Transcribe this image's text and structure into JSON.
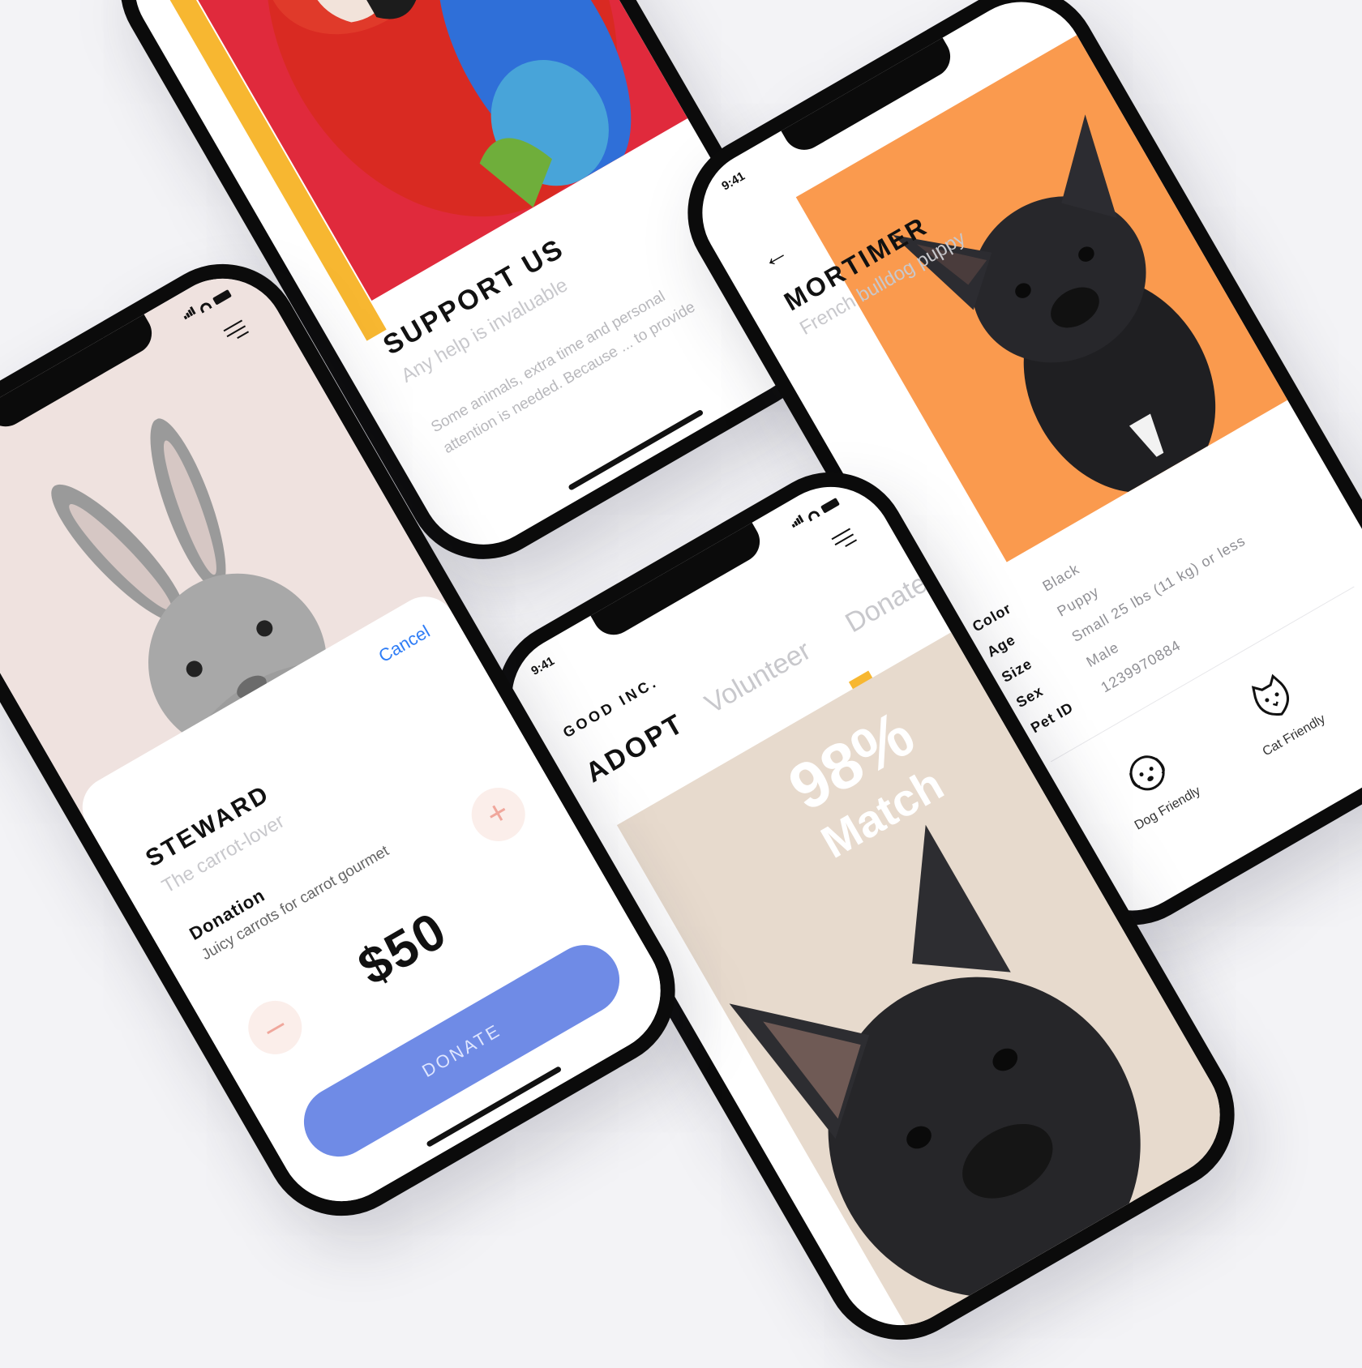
{
  "steward_screen": {
    "pet_name": "STEWARD",
    "pet_subtitle": "The carrot-lover",
    "cancel_label": "Cancel",
    "donation_label": "Donation",
    "donation_desc": "Juicy carrots for carrot gourmet",
    "amount": "$50",
    "decrement_label": "–",
    "increment_label": "+",
    "donate_label": "DONATE"
  },
  "support_screen": {
    "title": "SUPPORT US",
    "subtitle": "Any help is invaluable",
    "body": "Some animals, extra time and personal attention is needed. Because ... to provide"
  },
  "mortimer_screen": {
    "time": "9:41",
    "pet_name": "MORTIMER",
    "pet_subtitle": "French bulldog puppy",
    "attributes": [
      {
        "key": "Color",
        "value": "Black"
      },
      {
        "key": "Age",
        "value": "Puppy"
      },
      {
        "key": "Size",
        "value": "Small 25 lbs (11 kg) or less"
      },
      {
        "key": "Sex",
        "value": "Male"
      },
      {
        "key": "Pet ID",
        "value": "1239970884"
      }
    ],
    "friendly": [
      {
        "label": "Dog Friendly",
        "icon": "dog-icon"
      },
      {
        "label": "Cat Friendly",
        "icon": "cat-icon"
      }
    ]
  },
  "adopt_screen": {
    "time": "9:41",
    "brand": "GOOD INC.",
    "tabs": [
      "ADOPT",
      "Volunteer",
      "Donate"
    ],
    "match_percent": "98%",
    "match_label": "Match"
  },
  "colors": {
    "accent_yellow": "#f7b731",
    "parrot_red": "#e02a3c",
    "orange": "#fa9a4e",
    "donate_blue": "#6f8be6",
    "cancel_blue": "#2f7df6"
  }
}
